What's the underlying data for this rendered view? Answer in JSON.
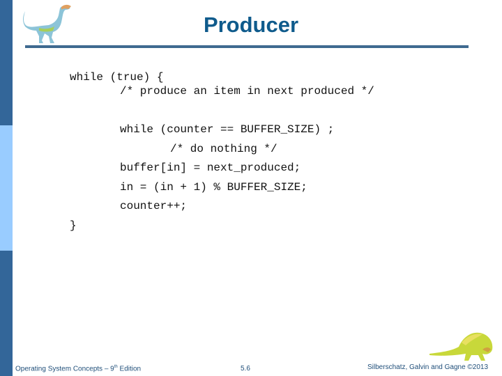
{
  "slide": {
    "title": "Producer",
    "code_lines": [
      {
        "indent": 0,
        "text": "while (true) {"
      },
      {
        "indent": 1,
        "text": "/* produce an item in next produced */"
      },
      {
        "indent": 1,
        "text": "while (counter == BUFFER_SIZE) ;"
      },
      {
        "indent": 2,
        "text": "/* do nothing */"
      },
      {
        "indent": 1,
        "text": "buffer[in] = next_produced;"
      },
      {
        "indent": 1,
        "text": "in = (in + 1) % BUFFER_SIZE;"
      },
      {
        "indent": 1,
        "text": "counter++;"
      },
      {
        "indent": 0,
        "text": "}"
      }
    ]
  },
  "footer": {
    "book_prefix": "Operating System Concepts – 9",
    "book_sup": "th",
    "book_suffix": " Edition",
    "page_number": "5.6",
    "copyright": "Silberschatz, Galvin and Gagne ©2013"
  },
  "colors": {
    "sidebar_dark": "#336699",
    "sidebar_light": "#99CCFF",
    "title": "#0F5B8C",
    "rule": "#3F6A90"
  }
}
